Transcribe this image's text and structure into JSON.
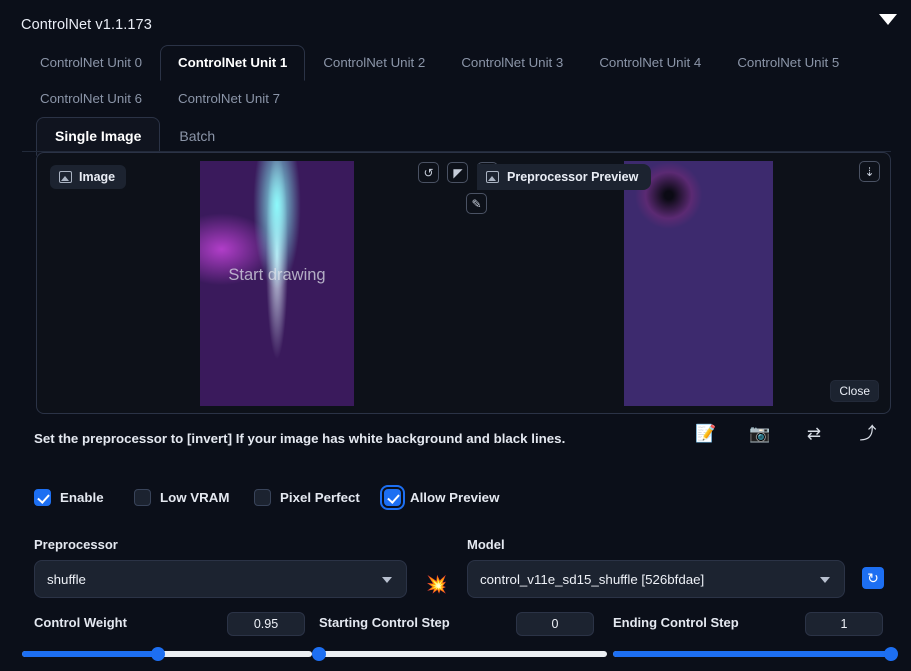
{
  "header": {
    "title": "ControlNet v1.1.173",
    "collapse_icon": "triangle-down-icon"
  },
  "unit_tabs": [
    {
      "label": "ControlNet Unit 0",
      "active": false
    },
    {
      "label": "ControlNet Unit 1",
      "active": true
    },
    {
      "label": "ControlNet Unit 2",
      "active": false
    },
    {
      "label": "ControlNet Unit 3",
      "active": false
    },
    {
      "label": "ControlNet Unit 4",
      "active": false
    },
    {
      "label": "ControlNet Unit 5",
      "active": false
    },
    {
      "label": "ControlNet Unit 6",
      "active": false
    },
    {
      "label": "ControlNet Unit 7",
      "active": false
    }
  ],
  "sub_tabs": [
    {
      "label": "Single Image",
      "active": true
    },
    {
      "label": "Batch",
      "active": false
    }
  ],
  "workspace": {
    "image_button_label": "Image",
    "preprocessor_preview_label": "Preprocessor Preview",
    "canvas_overlay_text": "Start drawing",
    "close_button_label": "Close",
    "tools": [
      {
        "name": "undo-icon",
        "glyph": "↺"
      },
      {
        "name": "eraser-icon",
        "glyph": "◤"
      },
      {
        "name": "close-icon",
        "glyph": "✕"
      },
      {
        "name": "brush-icon",
        "glyph": "✎"
      }
    ],
    "download_icon": "download-icon"
  },
  "hint": "Set the preprocessor to [invert] If your image has white background and black lines.",
  "action_icons": [
    {
      "name": "open-new-canvas-icon",
      "glyph": "📝"
    },
    {
      "name": "camera-icon",
      "glyph": "📷"
    },
    {
      "name": "swap-icon",
      "glyph": "⇄"
    },
    {
      "name": "send-to-icon",
      "glyph": "⤴"
    }
  ],
  "checkboxes": [
    {
      "label": "Enable",
      "checked": true,
      "focused": false
    },
    {
      "label": "Low VRAM",
      "checked": false,
      "focused": false
    },
    {
      "label": "Pixel Perfect",
      "checked": false,
      "focused": false
    },
    {
      "label": "Allow Preview",
      "checked": true,
      "focused": true
    }
  ],
  "preprocessor": {
    "label": "Preprocessor",
    "value": "shuffle",
    "explode_icon": "💥"
  },
  "model": {
    "label": "Model",
    "value": "control_v11e_sd15_shuffle [526bfdae]",
    "refresh_icon": "↻"
  },
  "sliders": [
    {
      "label": "Control Weight",
      "value": "0.95",
      "percent": 47
    },
    {
      "label": "Starting Control Step",
      "value": "0",
      "percent": 0
    },
    {
      "label": "Ending Control Step",
      "value": "1",
      "percent": 100
    }
  ],
  "colors": {
    "accent": "#1d6ff2",
    "background": "#0b0f19",
    "panel": "#10141f",
    "border": "#2b3346"
  }
}
